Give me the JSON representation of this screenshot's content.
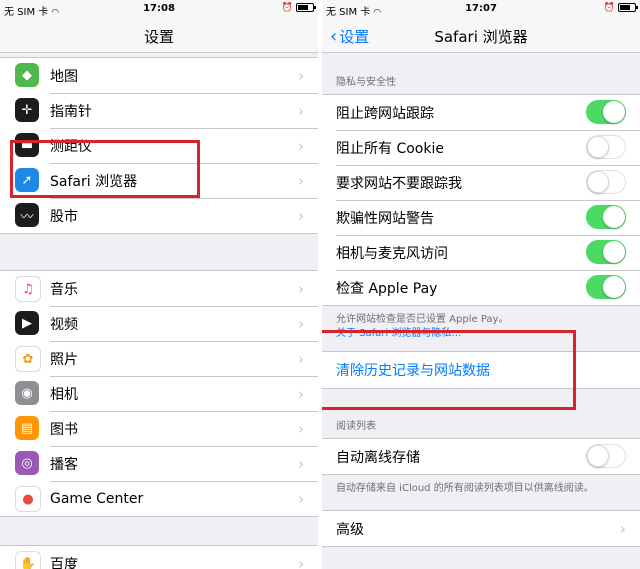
{
  "left": {
    "status": {
      "carrier": "无 SIM 卡",
      "time": "17:08"
    },
    "nav_title": "设置",
    "group1": [
      {
        "label": "地图",
        "icon": "maps-icon",
        "color": "#4fb94f",
        "glyph": "◆"
      },
      {
        "label": "指南针",
        "icon": "compass-icon",
        "color": "#1c1c1c",
        "glyph": "✛"
      },
      {
        "label": "测距仪",
        "icon": "measure-icon",
        "color": "#1c1c1c",
        "glyph": "▬"
      },
      {
        "label": "Safari 浏览器",
        "icon": "safari-icon",
        "color": "#1e88e5",
        "glyph": "➚"
      },
      {
        "label": "股市",
        "icon": "stocks-icon",
        "color": "#1c1c1c",
        "glyph": "〰"
      }
    ],
    "group2": [
      {
        "label": "音乐",
        "icon": "music-icon",
        "color": "#ffffff",
        "glyph": "♫",
        "fg": "#fc3c44"
      },
      {
        "label": "视频",
        "icon": "videos-icon",
        "color": "#1c1c1c",
        "glyph": "▶"
      },
      {
        "label": "照片",
        "icon": "photos-icon",
        "color": "#ffffff",
        "glyph": "✿",
        "fg": "#f39c12"
      },
      {
        "label": "相机",
        "icon": "camera-icon",
        "color": "#8e8e93",
        "glyph": "◉"
      },
      {
        "label": "图书",
        "icon": "books-icon",
        "color": "#ff9500",
        "glyph": "▤"
      },
      {
        "label": "播客",
        "icon": "podcasts-icon",
        "color": "#9b59b6",
        "glyph": "◎"
      },
      {
        "label": "Game Center",
        "icon": "game-center-icon",
        "color": "#ffffff",
        "glyph": "●",
        "fg": "#e74c3c"
      }
    ],
    "group3": [
      {
        "label": "百度",
        "icon": "baidu-icon",
        "color": "#ffffff",
        "glyph": "✋",
        "fg": "#2932e1"
      }
    ]
  },
  "right": {
    "status": {
      "carrier": "无 SIM 卡",
      "time": "17:07"
    },
    "back_label": "设置",
    "nav_title": "Safari 浏览器",
    "privacy_header": "隐私与安全性",
    "privacy_rows": [
      {
        "label": "阻止跨网站跟踪",
        "on": true
      },
      {
        "label": "阻止所有 Cookie",
        "on": false
      },
      {
        "label": "要求网站不要跟踪我",
        "on": false
      },
      {
        "label": "欺骗性网站警告",
        "on": true
      },
      {
        "label": "相机与麦克风访问",
        "on": true
      },
      {
        "label": "检查 Apple Pay",
        "on": true
      }
    ],
    "privacy_footer": "允许网站检查是否已设置 Apple Pay。",
    "privacy_footer_link": "关于 Safari 浏览器与隐私…",
    "clear_label": "清除历史记录与网站数据",
    "reading_header": "阅读列表",
    "offline_label": "自动离线存储",
    "offline_on": false,
    "reading_footer": "自动存储来自 iCloud 的所有阅读列表项目以供离线阅读。",
    "advanced_label": "高级"
  },
  "colors": {
    "accent": "#007aff",
    "toggle_on": "#4cd964",
    "highlight": "#d9232a"
  }
}
